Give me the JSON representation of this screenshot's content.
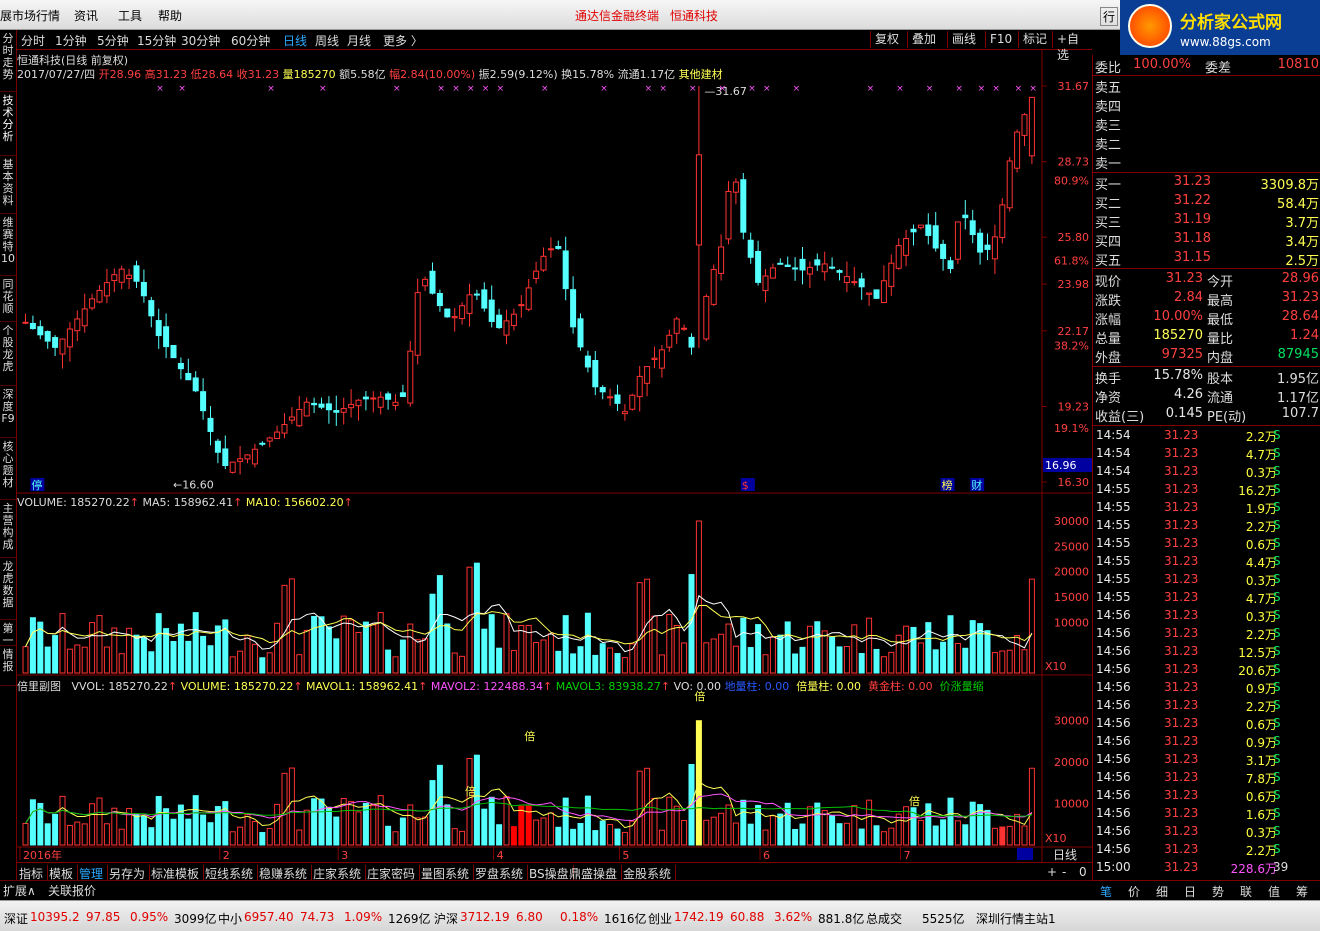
{
  "menu": [
    "展市场行情",
    "资讯",
    "工具",
    "帮助"
  ],
  "center_title": [
    "通达信金融终端",
    "恒通科技"
  ],
  "logo": {
    "title": "分析家公式网",
    "url": "www.88gs.com"
  },
  "left_tabs": [
    "分时走势",
    "技术分析",
    "基本资料",
    "维赛特10",
    "同花顺",
    "个股龙虎",
    "深度F9",
    "核心题材",
    "主营构成",
    "龙虎数据",
    "第一",
    "情报"
  ],
  "periods": [
    "分时",
    "1分钟",
    "5分钟",
    "15分钟",
    "30分钟",
    "60分钟",
    "日线",
    "周线",
    "月线",
    "更多 〉"
  ],
  "right_buttons": [
    "复权",
    "叠加",
    "画线",
    "F10",
    "标记",
    "+自选"
  ],
  "stock_header": "恒通科技(日线 前复权)",
  "quote_line": {
    "date": "2017/07/27/四",
    "open": "开28.96",
    "high": "高31.23",
    "low": "低28.64",
    "close": "收31.23",
    "vol": "量185270",
    "amount": "额5.58亿",
    "change": "幅2.84(10.00%)",
    "amp": "振2.59(9.12%)",
    "turnover": "换15.78%",
    "float": "流通1.17亿",
    "sector": "其他建材"
  },
  "main_axis": [
    "31.67",
    "28.73",
    "25.80",
    "23.98",
    "22.17",
    "19.23",
    "16.30"
  ],
  "main_pct": [
    "80.9%",
    "61.8%",
    "38.2%",
    "19.1%"
  ],
  "price_tag": "16.96",
  "marks": {
    "high": "31.67",
    "low": "16.60",
    "tag1": "停",
    "tag2": "$",
    "tag3": "榜",
    "tag4": "财"
  },
  "vol_line": {
    "a": "VOLUME: 185270.22",
    "b": "MA5: 158962.41",
    "c": "MA10: 156602.20"
  },
  "vol_axis": [
    "30000",
    "25000",
    "20000",
    "15000",
    "10000"
  ],
  "x10": "X10",
  "sub_line": {
    "name": "倍里副图",
    "a": "VVOL: 185270.22",
    "b": "VOLUME: 185270.22",
    "c": "MAVOL1: 158962.41",
    "d": "MAVOL2: 122488.34",
    "e": "MAVOL3: 83938.27",
    "f": "VO: 0.00",
    "g": "地量柱: 0.00",
    "h": "倍量柱: 0.00",
    "i": "黄金柱: 0.00",
    "j": "价涨量缩"
  },
  "sub_axis": [
    "30000",
    "20000",
    "10000"
  ],
  "sub_marks": {
    "bei": "倍"
  },
  "x_labels": [
    "2016年",
    "2",
    "3",
    "4",
    "5",
    "6",
    "7"
  ],
  "period_label": "日线",
  "bottom_tabs": [
    "指标",
    "模板",
    "管理",
    "另存为",
    "标准模板",
    "短线系统",
    "稳赚系统",
    "庄家系统",
    "庄家密码",
    "量图系统",
    "罗盘系统",
    "BS操盘",
    "鼎盛操盘",
    "金股系统"
  ],
  "ext_tabs": [
    "扩展∧",
    "关联报价"
  ],
  "nav_ctrl": [
    "+",
    "-",
    "0"
  ],
  "right_panel": {
    "weibi": {
      "l1": "委比",
      "v1": "100.00%",
      "l2": "委差",
      "v2": "10810"
    },
    "asks": [
      {
        "l": "卖五"
      },
      {
        "l": "卖四"
      },
      {
        "l": "卖三"
      },
      {
        "l": "卖二"
      },
      {
        "l": "卖一"
      }
    ],
    "bids": [
      {
        "l": "买一",
        "p": "31.23",
        "v": "3309.8万"
      },
      {
        "l": "买二",
        "p": "31.22",
        "v": "58.4万"
      },
      {
        "l": "买三",
        "p": "31.19",
        "v": "3.7万"
      },
      {
        "l": "买四",
        "p": "31.18",
        "v": "3.4万"
      },
      {
        "l": "买五",
        "p": "31.15",
        "v": "2.5万"
      }
    ],
    "stats": [
      {
        "l": "现价",
        "v": "31.23",
        "l2": "今开",
        "v2": "28.96"
      },
      {
        "l": "涨跌",
        "v": "2.84",
        "l2": "最高",
        "v2": "31.23"
      },
      {
        "l": "涨幅",
        "v": "10.00%",
        "l2": "最低",
        "v2": "28.64"
      },
      {
        "l": "总量",
        "v": "185270",
        "l2": "量比",
        "v2": "1.24"
      },
      {
        "l": "外盘",
        "v": "97325",
        "l2": "内盘",
        "v2": "87945"
      }
    ],
    "stats2": [
      {
        "l": "换手",
        "v": "15.78%",
        "l2": "股本",
        "v2": "1.95亿"
      },
      {
        "l": "净资",
        "v": "4.26",
        "l2": "流通",
        "v2": "1.17亿"
      },
      {
        "l": "收益(三)",
        "v": "0.145",
        "l2": "PE(动)",
        "v2": "107.7"
      }
    ],
    "ticks": [
      {
        "t": "14:54",
        "p": "31.23",
        "v": "2.2万",
        "s": "S"
      },
      {
        "t": "14:54",
        "p": "31.23",
        "v": "4.7万",
        "s": "S"
      },
      {
        "t": "14:54",
        "p": "31.23",
        "v": "0.3万",
        "s": "S"
      },
      {
        "t": "14:55",
        "p": "31.23",
        "v": "16.2万",
        "s": "S"
      },
      {
        "t": "14:55",
        "p": "31.23",
        "v": "1.9万",
        "s": "S"
      },
      {
        "t": "14:55",
        "p": "31.23",
        "v": "2.2万",
        "s": "S"
      },
      {
        "t": "14:55",
        "p": "31.23",
        "v": "0.6万",
        "s": "S"
      },
      {
        "t": "14:55",
        "p": "31.23",
        "v": "4.4万",
        "s": "S"
      },
      {
        "t": "14:55",
        "p": "31.23",
        "v": "0.3万",
        "s": "S"
      },
      {
        "t": "14:55",
        "p": "31.23",
        "v": "4.7万",
        "s": "S"
      },
      {
        "t": "14:56",
        "p": "31.23",
        "v": "0.3万",
        "s": "S"
      },
      {
        "t": "14:56",
        "p": "31.23",
        "v": "2.2万",
        "s": "S"
      },
      {
        "t": "14:56",
        "p": "31.23",
        "v": "12.5万",
        "s": "S"
      },
      {
        "t": "14:56",
        "p": "31.23",
        "v": "20.6万",
        "s": "S"
      },
      {
        "t": "14:56",
        "p": "31.23",
        "v": "0.9万",
        "s": "S"
      },
      {
        "t": "14:56",
        "p": "31.23",
        "v": "2.2万",
        "s": "S"
      },
      {
        "t": "14:56",
        "p": "31.23",
        "v": "0.6万",
        "s": "S"
      },
      {
        "t": "14:56",
        "p": "31.23",
        "v": "0.9万",
        "s": "S"
      },
      {
        "t": "14:56",
        "p": "31.23",
        "v": "3.1万",
        "s": "S"
      },
      {
        "t": "14:56",
        "p": "31.23",
        "v": "7.8万",
        "s": "S"
      },
      {
        "t": "14:56",
        "p": "31.23",
        "v": "0.6万",
        "s": "S"
      },
      {
        "t": "14:56",
        "p": "31.23",
        "v": "1.6万",
        "s": "S"
      },
      {
        "t": "14:56",
        "p": "31.23",
        "v": "0.3万",
        "s": "S"
      },
      {
        "t": "14:56",
        "p": "31.23",
        "v": "2.2万",
        "s": "S"
      },
      {
        "t": "15:00",
        "p": "31.23",
        "v": "228.6万",
        "s": "39"
      }
    ],
    "tabs": [
      "笔",
      "价",
      "细",
      "日",
      "势",
      "联",
      "值",
      "筹"
    ]
  },
  "status": [
    {
      "l": "深证",
      "v": "10395.2",
      "c": "97.85",
      "p": "0.95%",
      "a": "3099亿"
    },
    {
      "l": "中小",
      "v": "6957.40",
      "c": "74.73",
      "p": "1.09%",
      "a": "1269亿"
    },
    {
      "l": "沪深",
      "v": "3712.19",
      "c": "6.80",
      "p": "0.18%",
      "a": "1616亿"
    },
    {
      "l": "创业",
      "v": "1742.19",
      "c": "60.88",
      "p": "3.62%",
      "a": "881.8亿"
    }
  ],
  "status_tail": {
    "a": "总成交",
    "b": "5525亿",
    "c": "深圳行情主站1"
  },
  "colors": {
    "up": "#ff3232",
    "down": "#54ffff",
    "yellow": "#ffff54",
    "magenta": "#ff54ff",
    "green": "#00c000",
    "frame": "#800000"
  },
  "chart_data": {
    "type": "candlestick",
    "title": "恒通科技(日线 前复权)",
    "ylim": [
      16.3,
      31.67
    ],
    "y_ticks": [
      31.67,
      28.73,
      25.8,
      23.98,
      22.17,
      19.23,
      16.3
    ],
    "pct_ticks": [
      "80.9%",
      "61.8%",
      "38.2%",
      "19.1%"
    ],
    "high": 31.67,
    "low": 16.6,
    "last_close": 31.23,
    "volume_ylim": [
      0,
      30000
    ],
    "volume_ticks": [
      30000,
      25000,
      20000,
      15000,
      10000
    ],
    "x_labels": [
      "2016年",
      "2",
      "3",
      "4",
      "5",
      "6",
      "7"
    ]
  }
}
